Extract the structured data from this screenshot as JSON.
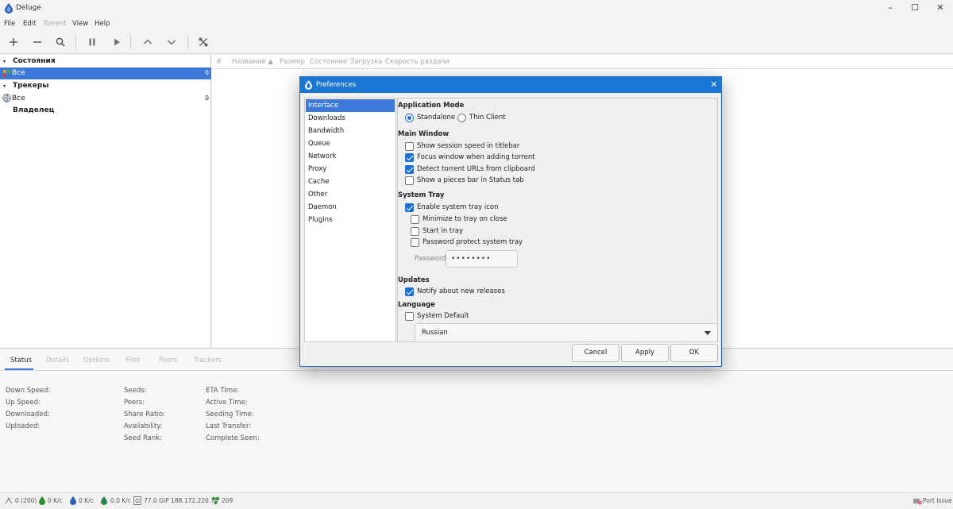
{
  "window": {
    "title": "Deluge",
    "minimize": "–",
    "maximize": "☐",
    "close": "✕"
  },
  "menu": [
    "File",
    "Edit",
    "Torrent",
    "View",
    "Help"
  ],
  "sidebar": {
    "states_label": "Состояния",
    "states_all": "Все",
    "states_all_count": "0",
    "trackers_label": "Трекеры",
    "trackers_all": "Все",
    "trackers_all_count": "0",
    "owner_label": "Владелец"
  },
  "torrent_columns": [
    "#",
    "Название ▲",
    "Размер",
    "Состояние",
    "Загрузка",
    "Скорость раздачи"
  ],
  "bottom_tabs": [
    "Status",
    "Details",
    "Options",
    "Files",
    "Peers",
    "Trackers"
  ],
  "status_labels": {
    "col1": [
      "Down Speed:",
      "Up Speed:",
      "Downloaded:",
      "Uploaded:"
    ],
    "col2": [
      "Seeds:",
      "Peers:",
      "Share Ratio:",
      "Availability:",
      "Seed Rank:"
    ],
    "col3": [
      "ETA Time:",
      "Active Time:",
      "Seeding Time:",
      "Last Transfer:",
      "Complete Seen:"
    ]
  },
  "statusbar": {
    "connections": "0 (200)",
    "down": "0 K/c",
    "up": "0 K/c",
    "protocol": "0.0 K/c",
    "disk": "77.0 G",
    "ip": "IP 188.172.220.75",
    "dht": "209",
    "port_issue": "Port Issue"
  },
  "dialog": {
    "title": "Preferences",
    "nav": [
      "Interface",
      "Downloads",
      "Bandwidth",
      "Queue",
      "Network",
      "Proxy",
      "Cache",
      "Other",
      "Daemon",
      "Plugins"
    ],
    "app_mode_title": "Application Mode",
    "standalone": "Standalone",
    "thin_client": "Thin Client",
    "main_window_title": "Main Window",
    "mw_opt1": "Show session speed in titlebar",
    "mw_opt2": "Focus window when adding torrent",
    "mw_opt3": "Detect torrent URLs from clipboard",
    "mw_opt4": "Show a pieces bar in Status tab",
    "tray_title": "System Tray",
    "tray_opt1": "Enable system tray icon",
    "tray_opt2": "Minimize to tray on close",
    "tray_opt3": "Start in tray",
    "tray_opt4": "Password protect system tray",
    "password_label": "Password:",
    "password_value": "••••••••",
    "updates_title": "Updates",
    "updates_opt": "Notify about new releases",
    "language_title": "Language",
    "lang_default": "System Default",
    "lang_value": "Russian",
    "cancel": "Cancel",
    "apply": "Apply",
    "ok": "OK"
  },
  "colors": {
    "accent": "#1976d2",
    "selection": "#3c78d8"
  }
}
